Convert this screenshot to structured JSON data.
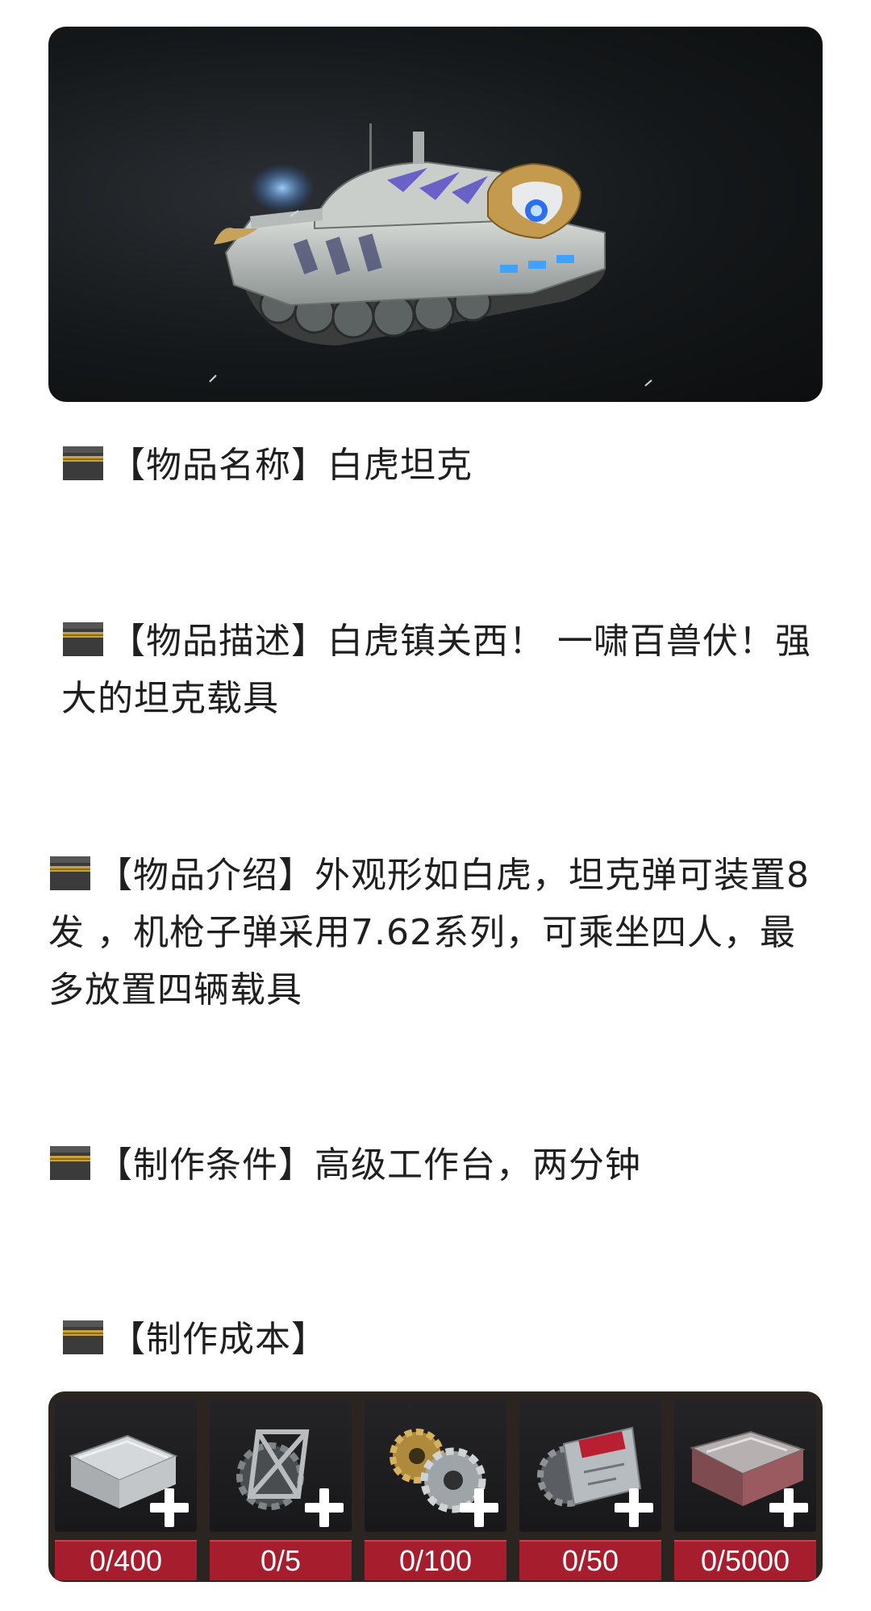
{
  "hero": {
    "icon": "white-tiger-tank-image"
  },
  "sections": {
    "name": {
      "icon": "kaaba-emoji",
      "text": "【物品名称】白虎坦克"
    },
    "description": {
      "icon": "kaaba-emoji",
      "text": "【物品描述】白虎镇关西！ 一啸百兽伏！强大的坦克载具"
    },
    "intro": {
      "icon": "kaaba-emoji",
      "text": "【物品介绍】外观形如白虎，坦克弹可装置8发 ，机枪子弹采用7.62系列，可乘坐四人，最多放置四辆载具"
    },
    "conditions": {
      "icon": "kaaba-emoji",
      "text": "【制作条件】高级工作台，两分钟"
    },
    "cost": {
      "icon": "kaaba-emoji",
      "text": "【制作成本】"
    }
  },
  "cost_items": [
    {
      "icon": "metal-case-icon",
      "count": "0/400"
    },
    {
      "icon": "gear-frame-icon",
      "count": "0/5"
    },
    {
      "icon": "gears-icon",
      "count": "0/100"
    },
    {
      "icon": "circuit-board-icon",
      "count": "0/50"
    },
    {
      "icon": "red-metal-case-icon",
      "count": "0/5000"
    }
  ],
  "colors": {
    "count_badge": "#a61e2e",
    "text": "#1f1f1f"
  }
}
